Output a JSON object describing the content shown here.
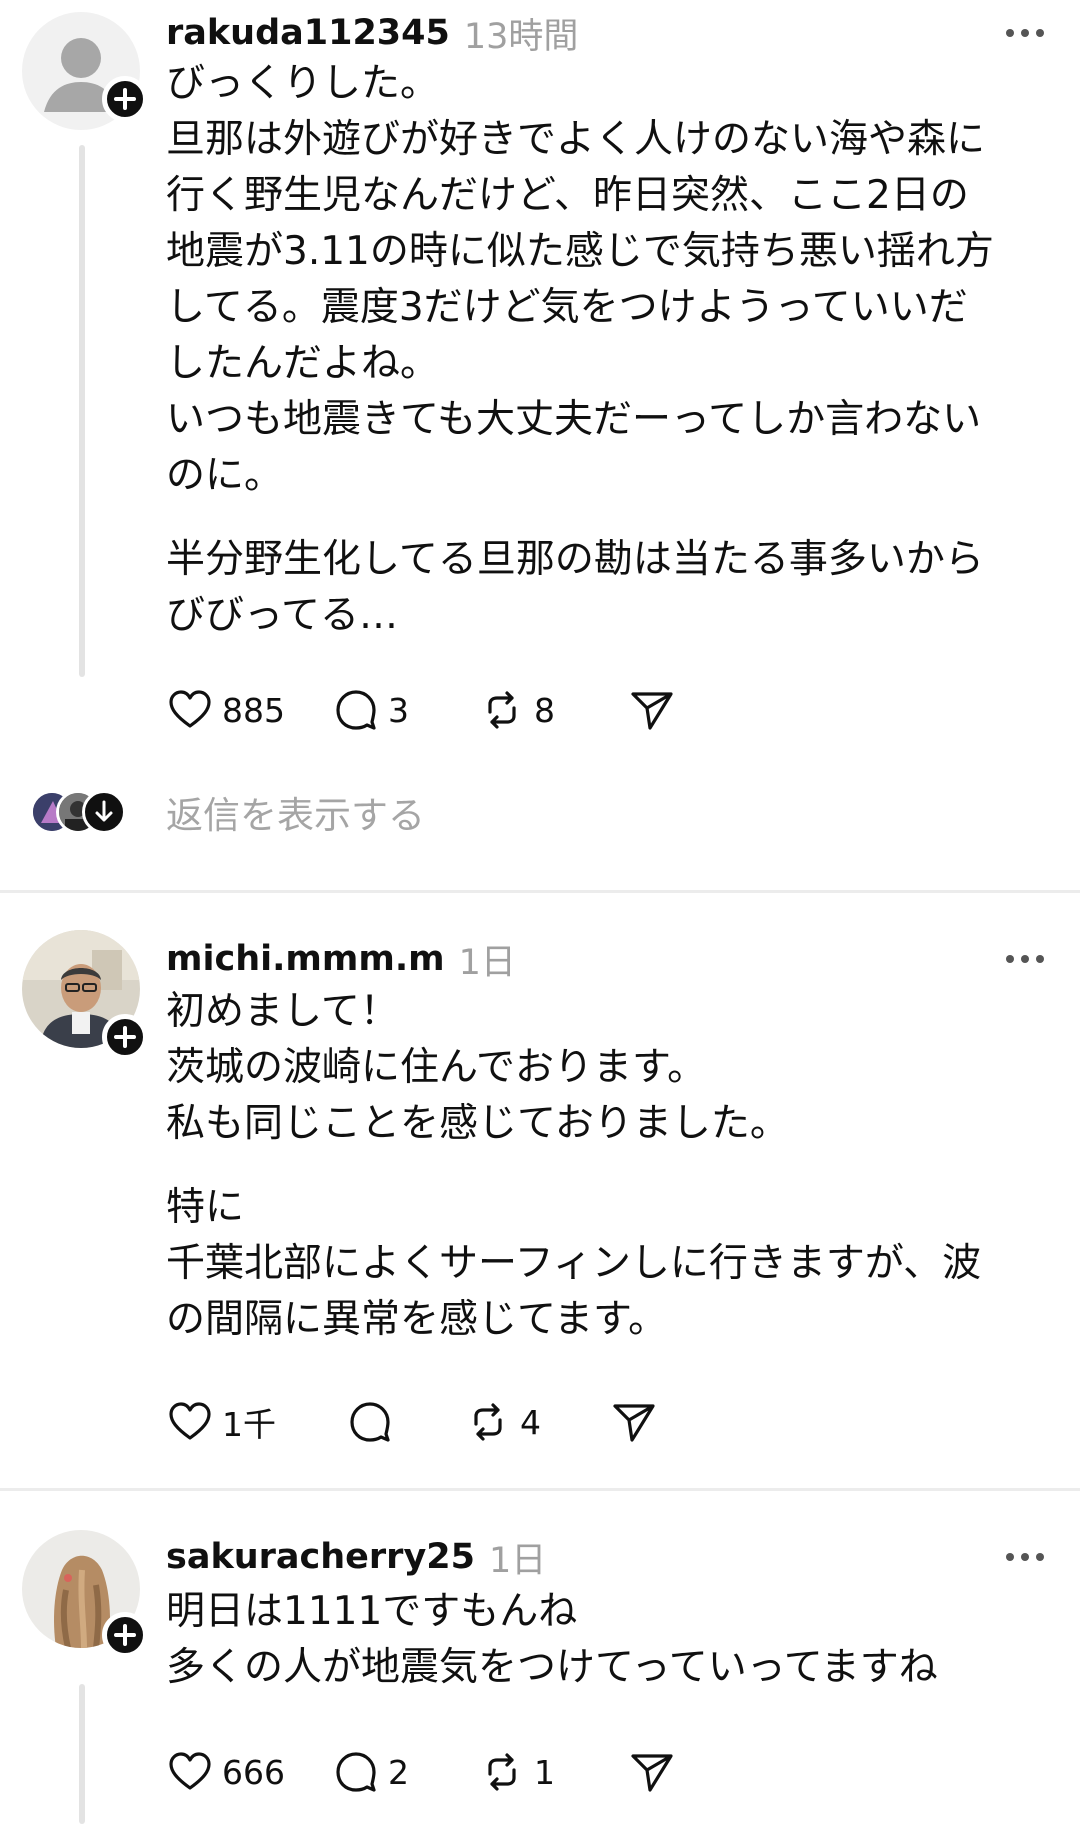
{
  "posts": [
    {
      "username": "rakuda112345",
      "time": "13時間",
      "paragraphs": [
        [
          "びっくりした。",
          "旦那は外遊びが好きでよく人けのない海や森に",
          "行く野生児なんだけど、昨日突然、ここ2日の",
          "地震が3.11の時に似た感じで気持ち悪い揺れ方",
          "してる。震度3だけど気をつけようっていいだ",
          "したんだよね。",
          "いつも地震きても大丈夫だーってしか言わない",
          "のに。"
        ],
        [
          "半分野生化してる旦那の勘は当たる事多いから",
          "びびってる…"
        ]
      ],
      "likes": "885",
      "replies_count": "3",
      "reposts": "8",
      "show_replies": "返信を表示する"
    },
    {
      "username": "michi.mmm.m",
      "time": "1日",
      "paragraphs": [
        [
          "初めまして！",
          "茨城の波崎に住んでおります。",
          "私も同じことを感じておりました。"
        ],
        [
          "特に",
          "千葉北部によくサーフィンしに行きますが、波",
          "の間隔に異常を感じてます。"
        ]
      ],
      "likes": "1千",
      "replies_count": "",
      "reposts": "4"
    },
    {
      "username": "sakuracherry25",
      "time": "1日",
      "paragraphs": [
        [
          "明日は1111ですもんね",
          "多くの人が地震気をつけてっていってますね"
        ]
      ],
      "likes": "666",
      "replies_count": "2",
      "reposts": "1"
    }
  ],
  "icons": {
    "like": "heart-icon",
    "reply": "speech-bubble-icon",
    "repost": "repost-icon",
    "share": "send-icon",
    "more": "more-dots-icon",
    "follow": "plus-icon",
    "expand": "arrow-down-icon"
  },
  "colors": {
    "text": "#101010",
    "muted": "#a0a0a0",
    "divider": "#ececec",
    "thread_line": "#e3e3e3"
  }
}
